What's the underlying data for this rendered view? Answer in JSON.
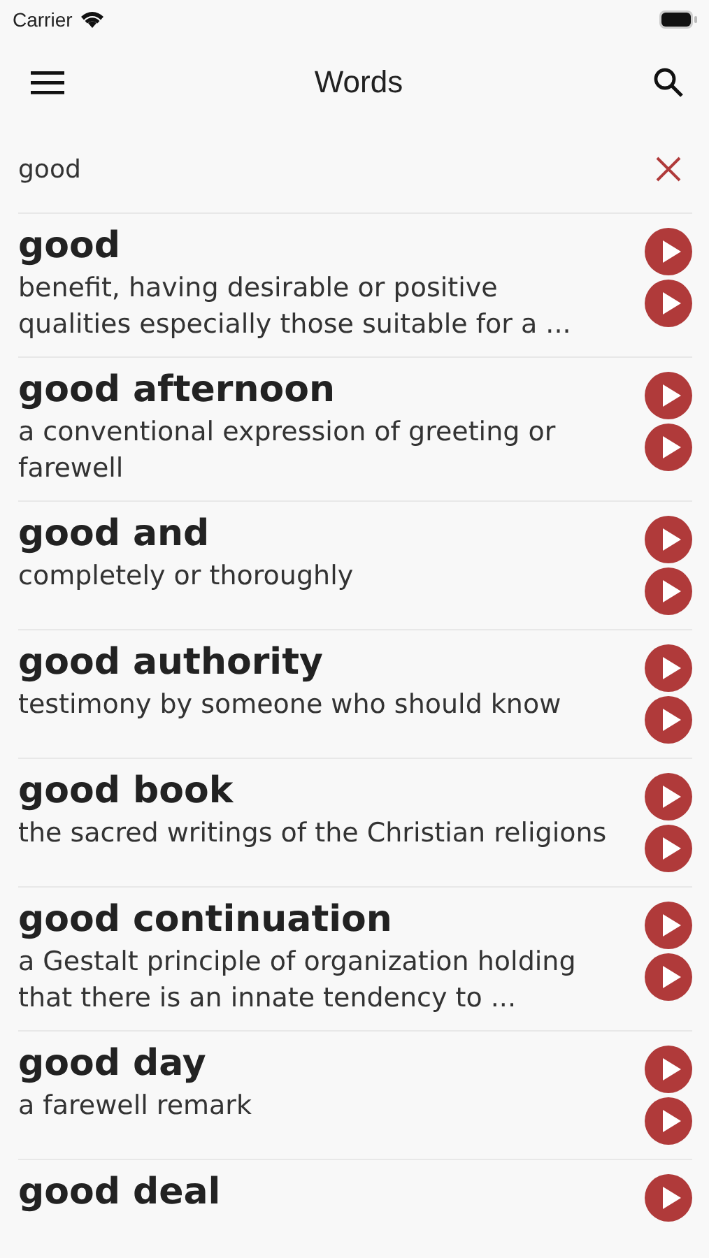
{
  "status_bar": {
    "carrier": "Carrier"
  },
  "header": {
    "title": "Words"
  },
  "search": {
    "value": "good"
  },
  "results": [
    {
      "word": "good",
      "definition": "benefit, having desirable or positive qualities especially those suitable for a ..."
    },
    {
      "word": "good afternoon",
      "definition": "a conventional expression of greeting or farewell"
    },
    {
      "word": "good and",
      "definition": "completely or thoroughly"
    },
    {
      "word": "good authority",
      "definition": "testimony by someone who should know"
    },
    {
      "word": "good book",
      "definition": "the sacred writings of the Christian religions"
    },
    {
      "word": "good continuation",
      "definition": "a Gestalt principle of organization holding that there is an innate tendency to ..."
    },
    {
      "word": "good day",
      "definition": "a farewell remark"
    },
    {
      "word": "good deal"
    }
  ]
}
